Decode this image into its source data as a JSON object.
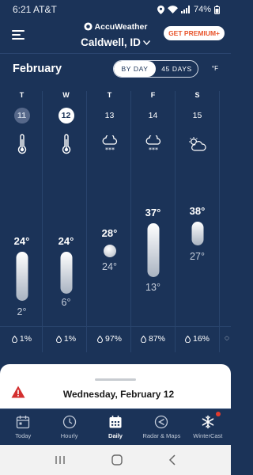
{
  "status_bar": {
    "time": "6:21",
    "carrier": "AT&T",
    "battery": "74%"
  },
  "header": {
    "brand": "AccuWeather",
    "location": "Caldwell, ID",
    "premium_button": "GET PREMIUM+"
  },
  "controls": {
    "month": "February",
    "view_options": [
      "BY DAY",
      "45 DAYS"
    ],
    "active_view": "BY DAY",
    "unit": "°F"
  },
  "days": [
    {
      "weekday": "T",
      "date": "11",
      "icon": "thermometer-icon",
      "hi": "24°",
      "lo": "2°",
      "precip": "1%",
      "state": "past"
    },
    {
      "weekday": "W",
      "date": "12",
      "icon": "thermometer-icon",
      "hi": "24°",
      "lo": "6°",
      "precip": "1%",
      "state": "today"
    },
    {
      "weekday": "T",
      "date": "13",
      "icon": "snow-cloud-icon",
      "hi": "28°",
      "lo": "24°",
      "precip": "97%",
      "state": "future"
    },
    {
      "weekday": "F",
      "date": "14",
      "icon": "snow-cloud-icon",
      "hi": "37°",
      "lo": "13°",
      "precip": "87%",
      "state": "future"
    },
    {
      "weekday": "S",
      "date": "15",
      "icon": "partly-cloudy-icon",
      "hi": "38°",
      "lo": "27°",
      "precip": "16%",
      "state": "future"
    }
  ],
  "bottom_sheet": {
    "title": "Wednesday, February 12"
  },
  "bottom_nav": [
    {
      "label": "Today",
      "icon": "calendar-today-icon"
    },
    {
      "label": "Hourly",
      "icon": "clock-icon"
    },
    {
      "label": "Daily",
      "icon": "calendar-daily-icon"
    },
    {
      "label": "Radar & Maps",
      "icon": "radar-icon"
    },
    {
      "label": "WinterCast",
      "icon": "snowflake-icon"
    }
  ],
  "active_nav": "Daily",
  "colors": {
    "background": "#1b3358",
    "accent": "#e8542b",
    "alert": "#d32f2f"
  }
}
